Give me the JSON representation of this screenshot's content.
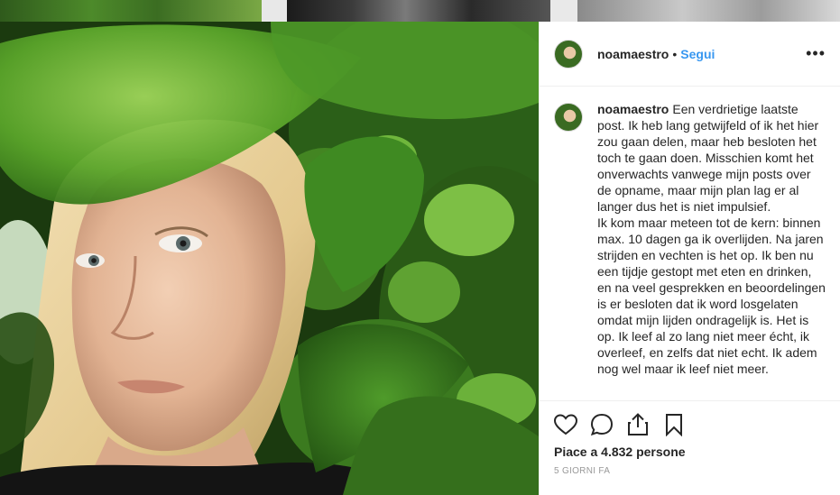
{
  "post": {
    "username": "noamaestro",
    "separator": "•",
    "follow_label": "Segui",
    "more_label": "•••",
    "caption_paragraphs": [
      "Een verdrietige laatste post. Ik heb lang getwijfeld of ik het hier zou gaan delen, maar heb besloten het toch te gaan doen. Misschien komt het onverwachts vanwege mijn posts over de opname, maar mijn plan lag er al langer dus het is niet impulsief.",
      "Ik kom maar meteen tot de kern: binnen max. 10 dagen ga ik overlijden. Na jaren strijden en vechten is het op. Ik ben nu een tijdje gestopt met eten en drinken, en na veel gesprekken en beoordelingen is er besloten dat ik word losgelaten omdat mijn lijden ondragelijk is. Het is op. Ik leef al zo lang niet meer écht, ik overleef, en zelfs dat niet echt. Ik adem nog wel maar ik leef niet meer."
    ],
    "likes_text": "Piace a 4.832 persone",
    "date_text": "5 GIORNI FA"
  },
  "icons": {
    "like": "heart-outline-icon",
    "comment": "speech-bubble-icon",
    "share": "share-upload-icon",
    "save": "bookmark-icon",
    "more": "more-horizontal-icon"
  },
  "colors": {
    "follow_link": "#3897f0",
    "text": "#262626",
    "muted": "#999999",
    "border": "#efefef"
  }
}
